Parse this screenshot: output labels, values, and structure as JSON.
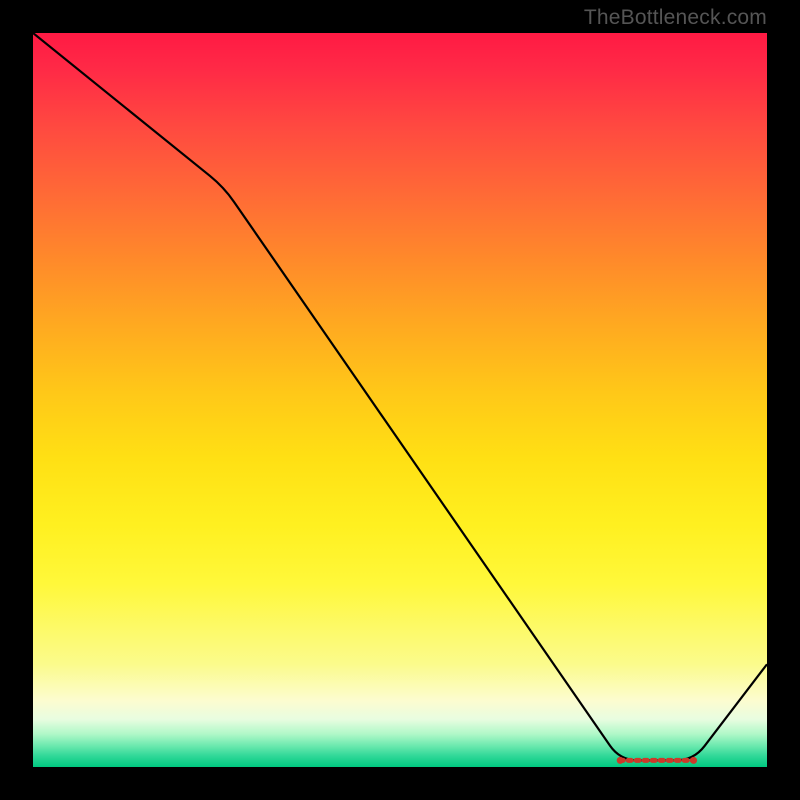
{
  "watermark_text": "TheBottleneck.com",
  "chart_data": {
    "type": "line",
    "title": "",
    "xlabel": "",
    "ylabel": "",
    "xlim": [
      0,
      100
    ],
    "ylim": [
      0,
      100
    ],
    "series": [
      {
        "name": "bottleneck-curve",
        "x": [
          0,
          26,
          80,
          90,
          100
        ],
        "y": [
          100,
          79,
          0.9,
          0.9,
          14
        ]
      }
    ],
    "annotations": [
      {
        "name": "optimal-segment",
        "x": [
          80,
          90
        ],
        "y": [
          0.9,
          0.9
        ],
        "color": "#cc3a2a",
        "style": "dotted"
      }
    ],
    "gradient_bands": "red-orange-yellow-green (top-to-bottom, green narrow at bottom)"
  }
}
